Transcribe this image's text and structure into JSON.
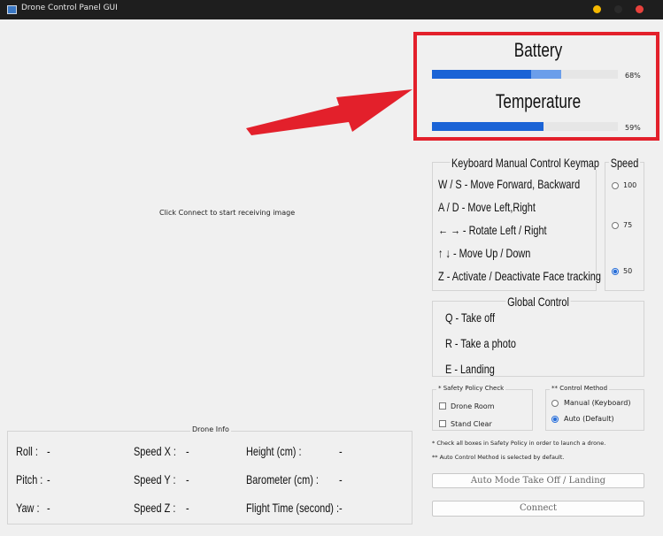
{
  "window": {
    "title": "Drone Control Panel GUI"
  },
  "video": {
    "placeholder": "Click Connect to start receiving image"
  },
  "status": {
    "battery_label": "Battery",
    "battery_value": "68%",
    "battery_level": 0.6,
    "temperature_label": "Temperature",
    "temperature_value": "59%",
    "temperature_level": 0.59
  },
  "keymap": {
    "title": "Keyboard Manual Control Keymap",
    "items": [
      "W / S - Move Forward, Backward",
      "A / D - Move Left,Right",
      "← → - Rotate Left / Right",
      "↑ ↓ - Move Up / Down",
      "Z - Activate / Deactivate Face tracking"
    ]
  },
  "speed": {
    "title": "Speed",
    "options": [
      "100",
      "75",
      "50"
    ],
    "selected": "50"
  },
  "global_control": {
    "title": "Global Control",
    "items": [
      "Q - Take off",
      "R - Take a photo",
      "E - Landing"
    ]
  },
  "safety": {
    "title": "* Safety Policy Check",
    "items": [
      "Drone Room",
      "Stand Clear"
    ]
  },
  "control_method": {
    "title": "** Control Method",
    "options": [
      "Manual (Keyboard)",
      "Auto (Default)"
    ],
    "selected": "Auto (Default)"
  },
  "notes": [
    "* Check all boxes in Safety Policy in order to launch a drone.",
    "** Auto Control Method is selected by default."
  ],
  "buttons": {
    "auto_mode": "Auto Mode Take Off / Landing",
    "connect": "Connect"
  },
  "drone_info": {
    "title": "Drone Info",
    "rows": [
      [
        {
          "label": "Roll :",
          "value": "-"
        },
        {
          "label": "Speed X :",
          "value": "-"
        },
        {
          "label": "Height (cm) :",
          "value": "-"
        }
      ],
      [
        {
          "label": "Pitch :",
          "value": "-"
        },
        {
          "label": "Speed Y :",
          "value": "-"
        },
        {
          "label": "Barometer (cm) :",
          "value": "-"
        }
      ],
      [
        {
          "label": "Yaw :",
          "value": "-"
        },
        {
          "label": "Speed Z :",
          "value": "-"
        },
        {
          "label": "Flight Time (second) :",
          "value": "-"
        }
      ]
    ]
  },
  "colors": {
    "titlebar": "#1e1e1e",
    "highlight_box": "#e3202b",
    "arrow": "#e3202b",
    "bar_fill": "#1a63d6",
    "bar_fill_light": "#6b9eea",
    "dot_yellow": "#f5b800",
    "dot_gray": "#2a2a2a",
    "dot_red": "#e8413c"
  }
}
